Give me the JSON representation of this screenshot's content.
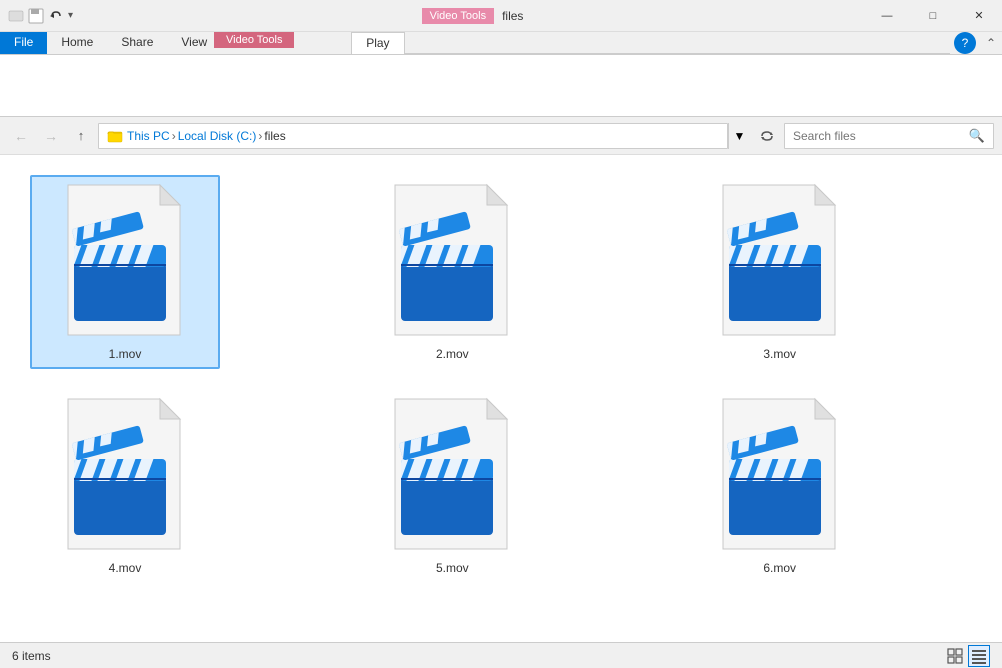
{
  "titleBar": {
    "appName": "files",
    "minimizeLabel": "—",
    "maximizeLabel": "☐",
    "closeLabel": "✕",
    "windowIcons": [
      "☰",
      "□",
      "⊟"
    ]
  },
  "ribbon": {
    "videoToolsLabel": "Video Tools",
    "tabs": [
      {
        "label": "File",
        "type": "file"
      },
      {
        "label": "Home",
        "type": "normal"
      },
      {
        "label": "Share",
        "type": "normal"
      },
      {
        "label": "View",
        "type": "normal"
      },
      {
        "label": "Play",
        "type": "active"
      }
    ]
  },
  "addressBar": {
    "backTitle": "Back",
    "forwardTitle": "Forward",
    "upTitle": "Up",
    "pathSegments": [
      "This PC",
      "Local Disk (C:)",
      "files"
    ],
    "refreshTitle": "Refresh",
    "searchPlaceholder": "Search files"
  },
  "files": [
    {
      "name": "1.mov",
      "selected": true
    },
    {
      "name": "2.mov",
      "selected": false
    },
    {
      "name": "3.mov",
      "selected": false
    },
    {
      "name": "4.mov",
      "selected": false
    },
    {
      "name": "5.mov",
      "selected": false
    },
    {
      "name": "6.mov",
      "selected": false
    }
  ],
  "statusBar": {
    "itemCount": "6 items",
    "viewLargeIconsTitle": "Large icons",
    "viewDetailsTitle": "Details"
  },
  "colors": {
    "videoToolsBg": "#e88aaa",
    "fileBg": "#0078d7",
    "selectedBg": "#cce8ff",
    "selectedBorder": "#5aabf0",
    "clapperBlue": "#1565C0",
    "clapperLightBlue": "#1E88E5",
    "accentBlue": "#0078d7"
  }
}
